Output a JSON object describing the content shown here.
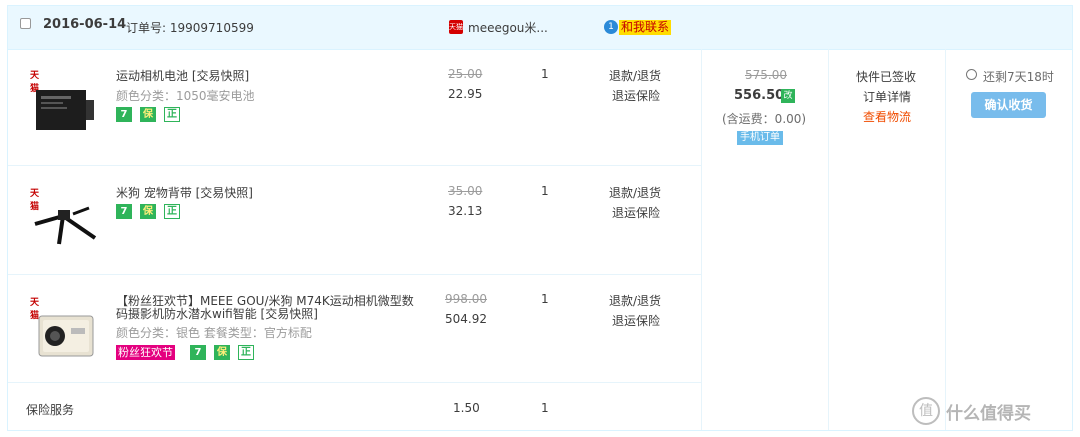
{
  "header": {
    "date": "2016-06-14",
    "order_label": "订单号:",
    "order_no": "19909710599",
    "shop_icon": "天猫",
    "shop_name": "meeegou米...",
    "badge": "1",
    "contact": "和我联系"
  },
  "items": [
    {
      "tmall_mark": "天猫",
      "title": "运动相机电池 [交易快照]",
      "sku": "颜色分类：1050毫安电池",
      "tags": [
        "7",
        "保",
        "正"
      ],
      "old_price": "25.00",
      "price": "22.95",
      "qty": "1",
      "service1": "退款/退货",
      "service2": "退运保险"
    },
    {
      "tmall_mark": "天猫",
      "title": "米狗 宠物背带 [交易快照]",
      "sku": "",
      "tags": [
        "7",
        "保",
        "正"
      ],
      "old_price": "35.00",
      "price": "32.13",
      "qty": "1",
      "service1": "退款/退货",
      "service2": "退运保险"
    },
    {
      "tmall_mark": "天猫",
      "title_line1": "【粉丝狂欢节】MEEE GOU/米狗 M74K运动相机微型数",
      "title_line2": "码摄影机防水潜水wifi智能 [交易快照]",
      "sku": "颜色分类：银色  套餐类型：官方标配",
      "fest": "粉丝狂欢节",
      "tags": [
        "7",
        "保",
        "正"
      ],
      "old_price": "998.00",
      "price": "504.92",
      "qty": "1",
      "service1": "退款/退货",
      "service2": "退运保险"
    }
  ],
  "insurance": {
    "label": "保险服务",
    "price": "1.50",
    "qty": "1"
  },
  "summary": {
    "old_total": "575.00",
    "total": "556.50",
    "modified_icon": "改",
    "shipping": "(含运费：0.00)",
    "mobile_order": "手机订单"
  },
  "status": {
    "signed": "快件已签收",
    "detail": "订单详情",
    "logistics": "查看物流"
  },
  "action": {
    "remain": "还剩7天18时",
    "confirm": "确认收货"
  },
  "watermark": {
    "icon": "值",
    "text": "什么值得买"
  },
  "colors": {
    "header_bg": "#eaf8ff",
    "accent_orange": "#f04c00",
    "confirm_btn": "#78bcec",
    "tag_green": "#2fb45a"
  }
}
